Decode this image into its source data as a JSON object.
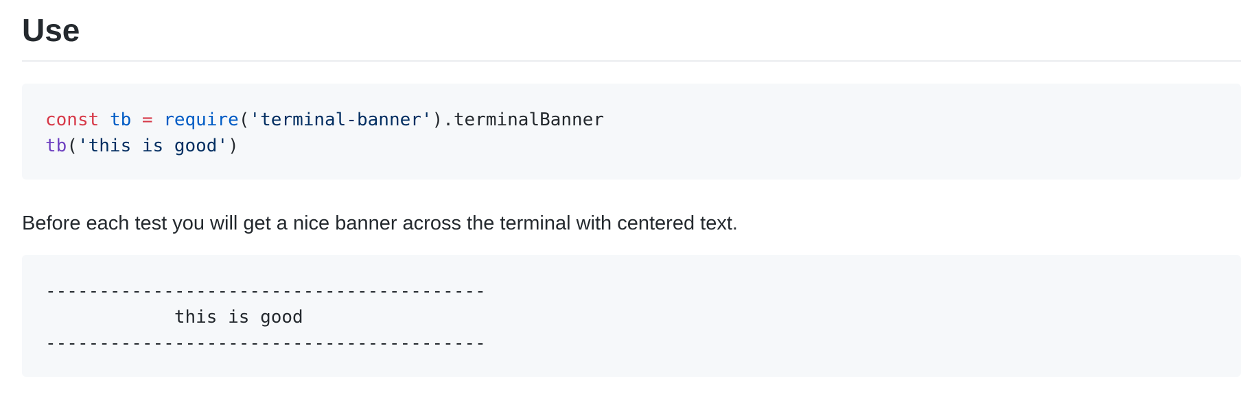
{
  "heading": "Use",
  "code_example": {
    "line1": {
      "keyword": "const",
      "variable": "tb",
      "operator": "=",
      "function": "require",
      "open": "(",
      "string": "'terminal-banner'",
      "rest": ").terminalBanner"
    },
    "line2": {
      "function": "tb",
      "open": "(",
      "string": "'this is good'",
      "close": ")"
    }
  },
  "description": "Before each test you will get a nice banner across the terminal with centered text.",
  "output_block": {
    "line1": "-----------------------------------------",
    "line2": "            this is good",
    "line3": "-----------------------------------------"
  },
  "colors": {
    "keyword": "#d73a49",
    "variable": "#005cc5",
    "function": "#6f42c1",
    "string": "#032f62",
    "code_background": "#f6f8fa",
    "text": "#24292e",
    "divider": "#eaecef"
  }
}
